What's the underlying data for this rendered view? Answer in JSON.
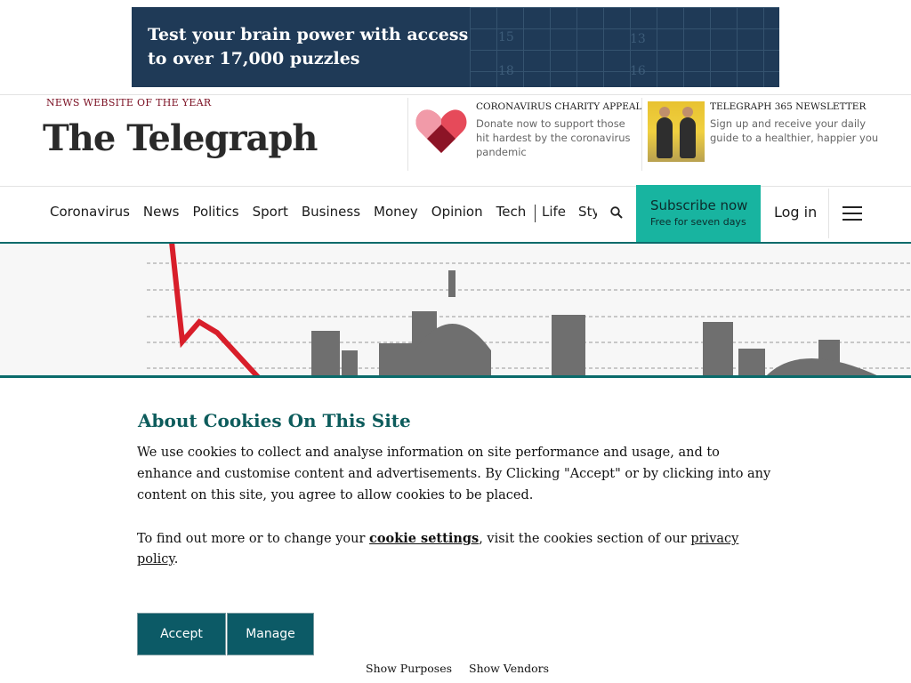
{
  "ad": {
    "line1": "Test your brain power with access",
    "line2": "to over 17,000 puzzles",
    "grid_numbers": [
      "15",
      "13",
      "18",
      "16"
    ]
  },
  "header": {
    "award": "NEWS WEBSITE OF THE YEAR",
    "masthead": "The Telegraph",
    "charity": {
      "title": "CORONAVIRUS CHARITY APPEAL",
      "lines": [
        "Donate now to support those",
        "hit hardest by the coronavirus",
        "pandemic"
      ]
    },
    "newsletter": {
      "title": "TELEGRAPH 365 NEWSLETTER",
      "lines": [
        "Sign up and receive your daily",
        "guide to a healthier, happier you"
      ]
    }
  },
  "nav": {
    "items": [
      "Coronavirus",
      "News",
      "Politics",
      "Sport",
      "Business",
      "Money",
      "Opinion",
      "Tech"
    ],
    "overflow_items": [
      "Life",
      "Style"
    ],
    "subscribe_label": "Subscribe now",
    "subscribe_sub": "Free for seven days",
    "login_label": "Log in"
  },
  "cookie": {
    "title": "About Cookies On This Site",
    "line1": "We use cookies to collect and analyse information on site performance and usage, and to",
    "line2": "enhance and customise content and advertisements. By Clicking \"Accept\" or by clicking into any",
    "line3": "content on this site, you agree to allow cookies to be placed.",
    "more_prefix": "To find out more or to change your ",
    "cookie_settings_link": "cookie settings",
    "more_middle": ", visit the cookies section of our ",
    "privacy_link_1": "privacy",
    "privacy_link_2": "policy",
    "more_suffix": ".",
    "accept_label": "Accept",
    "manage_label": "Manage",
    "show_purposes": "Show Purposes",
    "show_vendors": "Show Vendors"
  },
  "colors": {
    "ad_bg": "#1f3a57",
    "brand_teal": "#0d5c5c",
    "subscribe_bg": "#18b4a0",
    "button_bg": "#0c5a66",
    "award_red": "#7a0e21"
  }
}
